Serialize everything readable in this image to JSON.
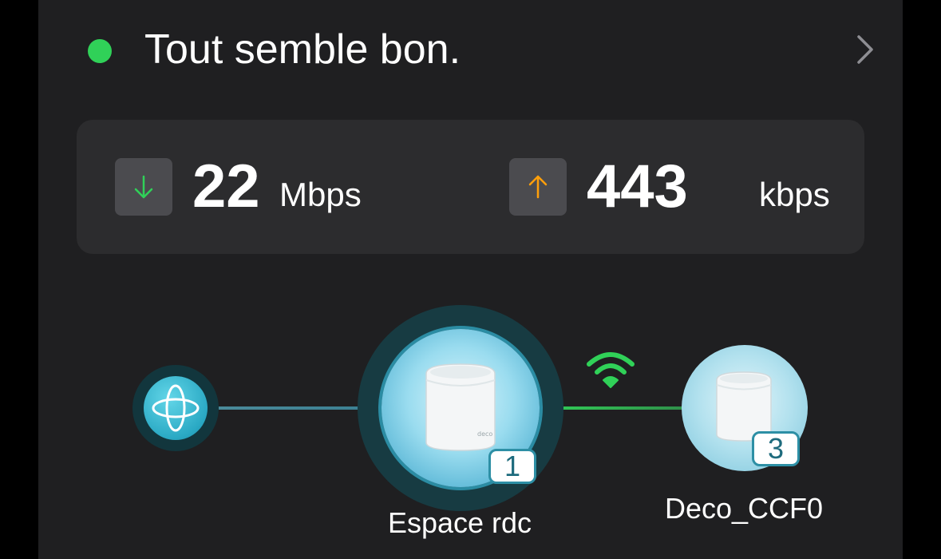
{
  "status": {
    "text": "Tout semble bon.",
    "dot_color": "#30d158",
    "icons": {
      "indicator": "status-dot",
      "navigate": "chevron-right-icon"
    }
  },
  "speeds": {
    "download": {
      "value": "22",
      "unit": "Mbps",
      "icon": "arrow-down-icon",
      "color": "#30d158"
    },
    "upload": {
      "value": "443",
      "unit": "kbps",
      "icon": "arrow-up-icon",
      "color": "#ff9f0a"
    }
  },
  "topology": {
    "internet": {
      "icon": "globe-icon"
    },
    "main_node": {
      "label": "Espace rdc",
      "clients": "1",
      "icon": "deco-router-icon"
    },
    "link_icon": "wifi-icon",
    "link_color": "#30d158",
    "satellite_node": {
      "label": "Deco_CCF0",
      "clients": "3",
      "icon": "deco-router-icon"
    }
  }
}
